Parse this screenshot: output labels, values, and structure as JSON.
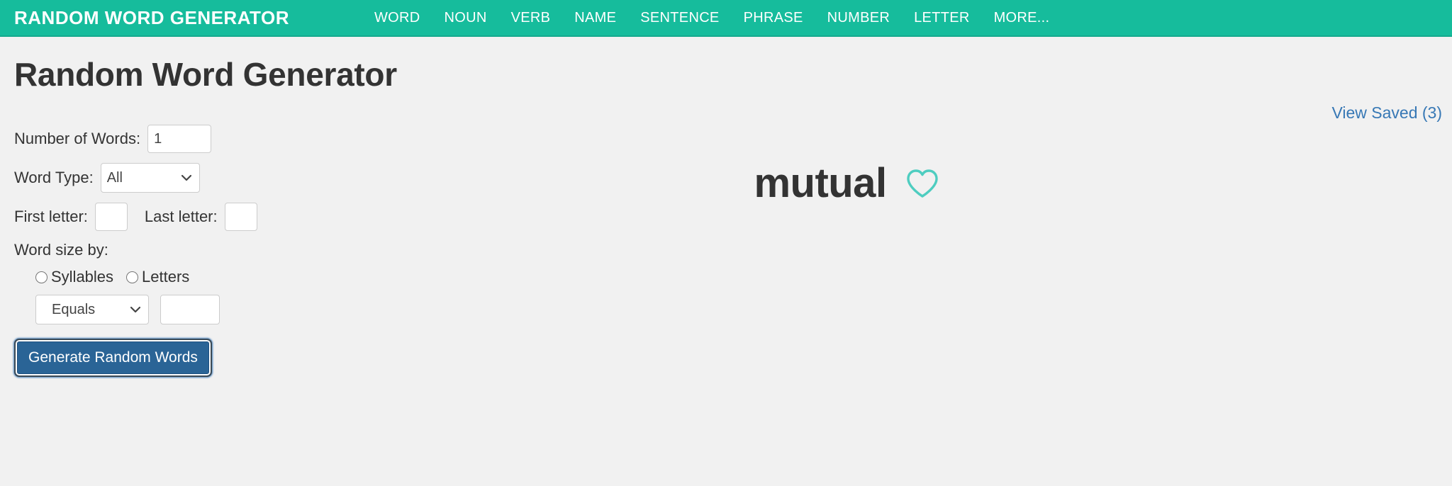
{
  "header": {
    "brand": "RANDOM WORD GENERATOR",
    "nav": [
      {
        "label": "WORD"
      },
      {
        "label": "NOUN"
      },
      {
        "label": "VERB"
      },
      {
        "label": "NAME"
      },
      {
        "label": "SENTENCE"
      },
      {
        "label": "PHRASE"
      },
      {
        "label": "NUMBER"
      },
      {
        "label": "LETTER"
      },
      {
        "label": "MORE..."
      }
    ],
    "background_color": "#16bc9c"
  },
  "page": {
    "title": "Random Word Generator",
    "background_color": "#f1f1f1"
  },
  "form": {
    "number_of_words": {
      "label": "Number of Words:",
      "value": "1",
      "placeholder": ""
    },
    "word_type": {
      "label": "Word Type:",
      "value": "All",
      "options": [
        "All"
      ],
      "icon": "chevron-down-icon"
    },
    "first_letter": {
      "label": "First letter:",
      "value": "",
      "placeholder": ""
    },
    "last_letter": {
      "label": "Last letter:",
      "value": "",
      "placeholder": ""
    },
    "word_size": {
      "label": "Word size by:",
      "radios": [
        {
          "label": "Syllables",
          "checked": false
        },
        {
          "label": "Letters",
          "checked": false
        }
      ],
      "comparison": {
        "value": "Equals",
        "options": [
          "Equals"
        ],
        "icon": "chevron-down-icon"
      },
      "size_value": {
        "value": "",
        "placeholder": ""
      }
    },
    "generate_button": {
      "label": "Generate Random Words",
      "color": "#2a6496"
    }
  },
  "results": {
    "view_saved": {
      "label": "View Saved (3)",
      "color": "#3778b5"
    },
    "word": "mutual",
    "favorite": {
      "icon": "heart-icon",
      "filled": false,
      "color": "#4ecdc0"
    }
  }
}
